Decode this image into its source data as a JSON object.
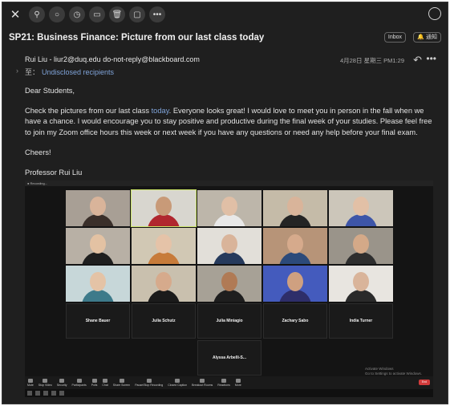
{
  "toolbar": {
    "close": "✕",
    "pin": "⚲",
    "circle": "○",
    "clock": "◷",
    "archive": "▭",
    "trash": "🗑",
    "folder": "▢",
    "more": "•••"
  },
  "email": {
    "subject": "SP21: Business Finance: Picture from our last class today",
    "tag_inbox": "Inbox",
    "tag_notify": "🔔 通知",
    "from": "Rui Liu - liur2@duq.edu do-not-reply@blackboard.com",
    "date": "4月28日 星期三 PM1:29",
    "to_label": "至：",
    "recipients": "Undisclosed recipients",
    "greeting": "Dear Students,",
    "p1_before": "Check the pictures from our last class ",
    "p1_link": "today",
    "p1_after": ". Everyone looks great! I would love to meet you in person in the fall when we have a chance. I would encourage you to stay positive and productive during the final week of your studies. Please feel free to join my Zoom office hours this week or next week if you have any questions or need any help before your final exam.",
    "closing": "Cheers!",
    "signature": "Professor Rui Liu"
  },
  "zoom": {
    "recording": "● Recording...",
    "tiles": [
      [
        {
          "skin": "#d9b49a",
          "shirt": "#3a2f2a",
          "bg": "#a89f95"
        },
        {
          "skin": "#c89a78",
          "shirt": "#b0262e",
          "bg": "#d8d6cf",
          "active": true
        },
        {
          "skin": "#e0bfa6",
          "shirt": "#e8e8e8",
          "bg": "#bdb6aa"
        },
        {
          "skin": "#d9b49a",
          "shirt": "#242424",
          "bg": "#c5bba8"
        },
        {
          "skin": "#e2c0a6",
          "shirt": "#3d55a8",
          "bg": "#ccc6ba"
        }
      ],
      [
        {
          "skin": "#e3c2a3",
          "shirt": "#1f1f1f",
          "bg": "#b8b0a5"
        },
        {
          "skin": "#e5c3a8",
          "shirt": "#c77b3a",
          "bg": "#d1c8b4"
        },
        {
          "skin": "#d9b49a",
          "shirt": "#263a5c",
          "bg": "#e2dfd9"
        },
        {
          "skin": "#d6aa8c",
          "shirt": "#2c4a7a",
          "bg": "#b79478"
        },
        {
          "skin": "#d4a988",
          "shirt": "#2e2e2e",
          "bg": "#9a948a"
        }
      ],
      [
        {
          "skin": "#e4c3a6",
          "shirt": "#3d7a8a",
          "bg": "#c7d7d9"
        },
        {
          "skin": "#d6aa8c",
          "shirt": "#1b1b1b",
          "bg": "#c9c0ae"
        },
        {
          "skin": "#b07a55",
          "shirt": "#1e1e1e",
          "bg": "#a7a196"
        },
        {
          "skin": "#cfa080",
          "shirt": "#2e2e6a",
          "bg": "#445bbd"
        },
        {
          "skin": "#d9b49a",
          "shirt": "#2a2a2a",
          "bg": "#e8e5e0"
        }
      ]
    ],
    "names_row": [
      "Shane Bauer",
      "Julia Schutz",
      "Julia Miniagio",
      "Zachary Sabo",
      "India Turner"
    ],
    "last_name": "Alyssa  Arbelli-S...",
    "controls": [
      "Mute",
      "Stop Video",
      "Security",
      "Participants",
      "Polls",
      "Chat",
      "Share Screen",
      "Pause/Stop Recording",
      "Closed Caption",
      "Breakout Rooms",
      "Reactions",
      "More"
    ],
    "end": "End",
    "activate_1": "Activate Windows",
    "activate_2": "Go to Settings to activate Windows."
  }
}
